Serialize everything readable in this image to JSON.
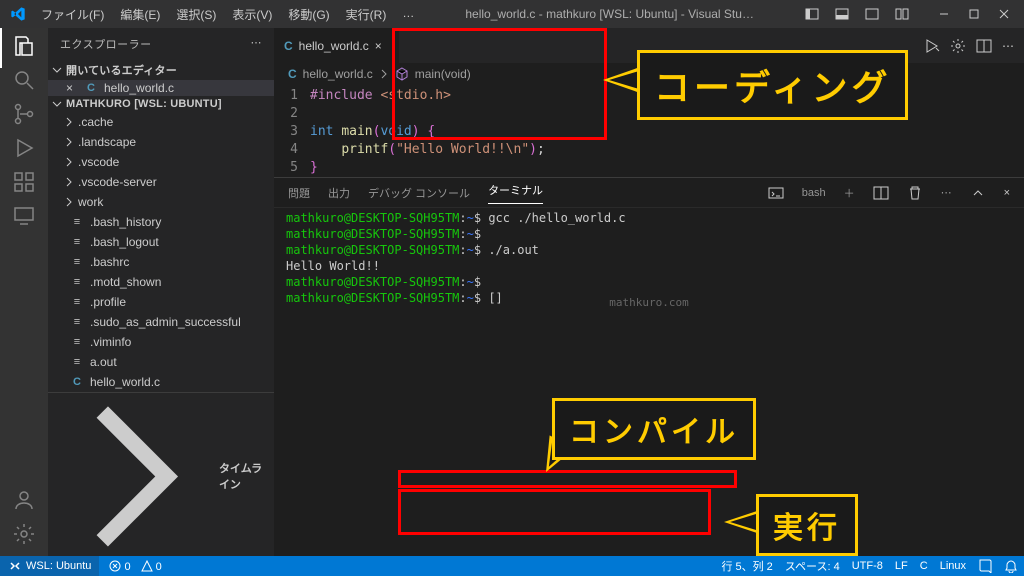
{
  "titlebar": {
    "menu": [
      "ファイル(F)",
      "編集(E)",
      "選択(S)",
      "表示(V)",
      "移動(G)",
      "実行(R)",
      "…"
    ],
    "title": "hello_world.c - mathkuro [WSL: Ubuntu] - Visual Stu…"
  },
  "sidebar": {
    "title": "エクスプローラー",
    "open_editors_label": "開いているエディター",
    "open_editors": [
      {
        "name": "hello_world.c",
        "icon": "c"
      }
    ],
    "workspace_label": "MATHKURO [WSL: UBUNTU]",
    "files": [
      {
        "name": ".cache",
        "kind": "folder"
      },
      {
        "name": ".landscape",
        "kind": "folder"
      },
      {
        "name": ".vscode",
        "kind": "folder"
      },
      {
        "name": ".vscode-server",
        "kind": "folder"
      },
      {
        "name": "work",
        "kind": "folder"
      },
      {
        "name": ".bash_history",
        "kind": "file"
      },
      {
        "name": ".bash_logout",
        "kind": "file"
      },
      {
        "name": ".bashrc",
        "kind": "file"
      },
      {
        "name": ".motd_shown",
        "kind": "file"
      },
      {
        "name": ".profile",
        "kind": "file"
      },
      {
        "name": ".sudo_as_admin_successful",
        "kind": "file"
      },
      {
        "name": ".viminfo",
        "kind": "file"
      },
      {
        "name": "a.out",
        "kind": "file"
      },
      {
        "name": "hello_world.c",
        "kind": "c"
      }
    ],
    "timeline_label": "タイムライン"
  },
  "tabs": {
    "active": "hello_world.c"
  },
  "breadcrumb": {
    "file": "hello_world.c",
    "symbol": "main(void)"
  },
  "code": {
    "lines": [
      {
        "html": "<span class='tok-macro'>#include</span> <span class='tok-inc'>&lt;stdio.h&gt;</span>"
      },
      {
        "html": ""
      },
      {
        "html": "<span class='tok-kw'>int</span> <span class='tok-fn'>main</span><span class='tok-brace'>(</span><span class='tok-kw'>void</span><span class='tok-brace'>)</span> <span class='tok-brace'>{</span>"
      },
      {
        "html": "    <span class='tok-fn'>printf</span><span class='tok-brace'>(</span><span class='tok-str'>\"Hello World!!\\n\"</span><span class='tok-brace'>)</span><span class='tok-punc'>;</span>"
      },
      {
        "html": "<span class='tok-brace'>}</span>"
      }
    ]
  },
  "panel": {
    "tabs": [
      "問題",
      "出力",
      "デバッグ コンソール",
      "ターミナル"
    ],
    "active": 3,
    "shell_label": "bash",
    "term_lines": [
      {
        "prompt": "mathkuro@DESKTOP-SQH95TM:~$",
        "cmd": " gcc ./hello_world.c"
      },
      {
        "prompt": "mathkuro@DESKTOP-SQH95TM:~$",
        "cmd": ""
      },
      {
        "prompt": "mathkuro@DESKTOP-SQH95TM:~$",
        "cmd": " ./a.out"
      },
      {
        "out": "Hello World!!"
      },
      {
        "prompt": "mathkuro@DESKTOP-SQH95TM:~$",
        "cmd": ""
      },
      {
        "prompt": "mathkuro@DESKTOP-SQH95TM:~$",
        "cmd": " []"
      }
    ],
    "watermark": "mathkuro.com"
  },
  "status": {
    "remote": "WSL: Ubuntu",
    "errors": "0",
    "warnings": "0",
    "pos": "行 5、列 2",
    "spaces": "スペース: 4",
    "enc": "UTF-8",
    "eol": "LF",
    "lang": "C",
    "os": "Linux"
  },
  "callouts": {
    "coding": "コーディング",
    "compile": "コンパイル",
    "run": "実行"
  }
}
